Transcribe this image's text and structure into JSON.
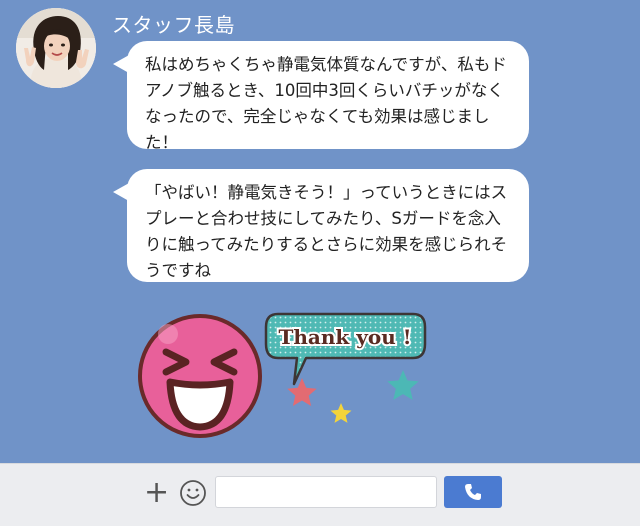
{
  "chat": {
    "sender_name": "スタッフ長島",
    "messages": [
      "私はめちゃくちゃ静電気体質なんですが、私もドアノブ触るとき、10回中3回くらいバチッがなくなったので、完全じゃなくても効果は感じました！",
      "「やばい！静電気きそう！」っていうときにはスプレーと合わせ技にしてみたり、Sガードを念入りに触ってみたりするとさらに効果を感じられそうですね"
    ],
    "sticker": {
      "speech_text": "Thank you !",
      "face_color": "#e8609a",
      "bubble_color": "#4fb9b4",
      "star_colors": [
        "#e36b72",
        "#f4d43a",
        "#4cb8b5"
      ]
    }
  },
  "input_bar": {
    "plus_label": "+",
    "message_placeholder": "",
    "icons": [
      "plus-icon",
      "smiley-icon",
      "phone-icon"
    ],
    "send_color": "#4b7bd1"
  },
  "colors": {
    "background": "#7093c8",
    "bubble": "#ffffff"
  }
}
